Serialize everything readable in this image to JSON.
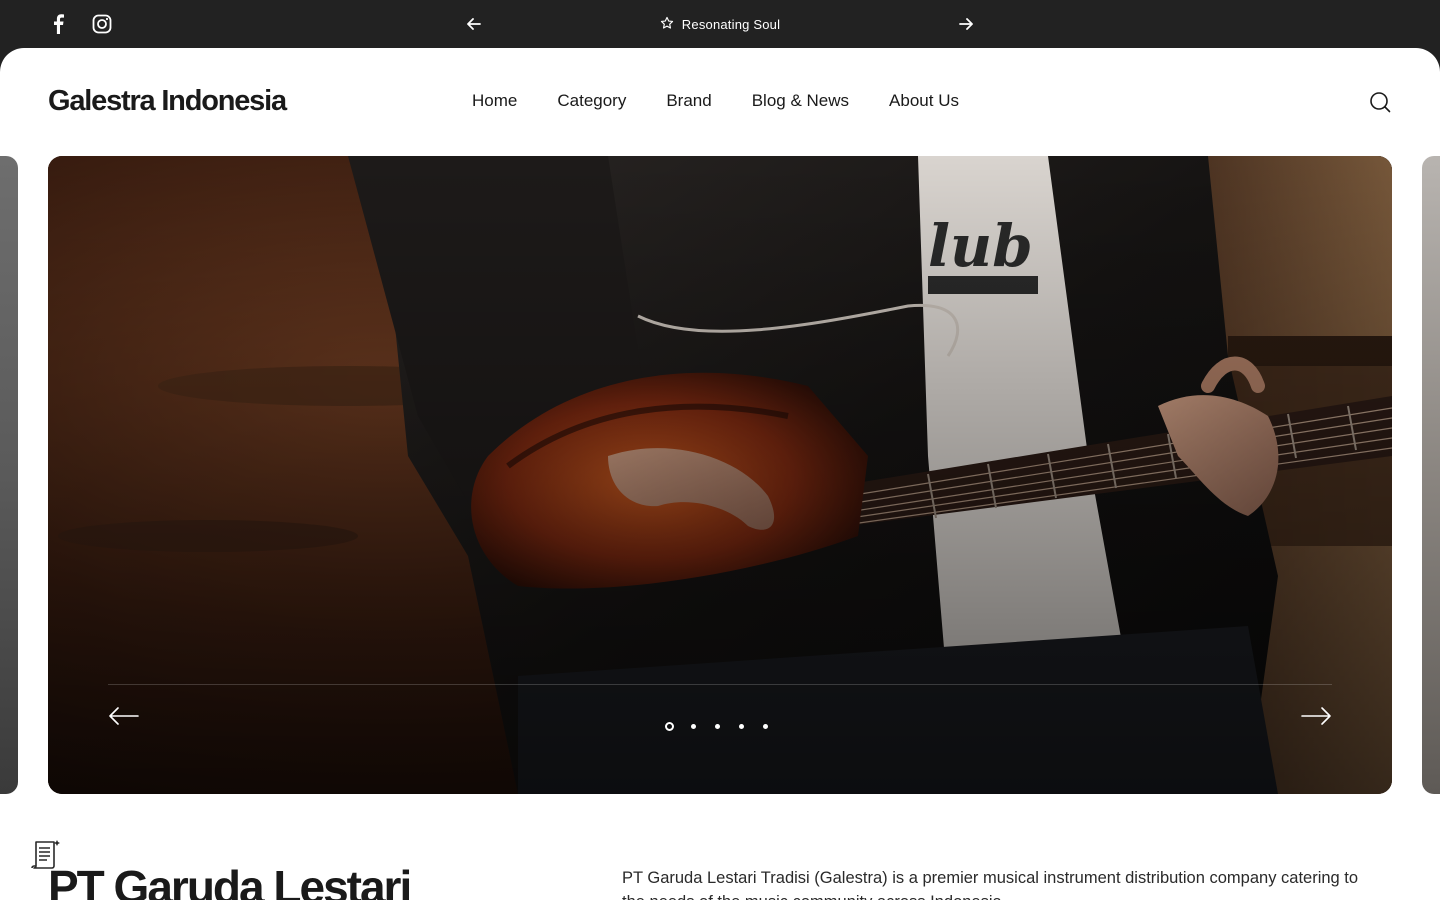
{
  "topbar": {
    "social": [
      {
        "name": "facebook-icon"
      },
      {
        "name": "instagram-icon"
      }
    ],
    "announcement": "Resonating Soul",
    "announcement_icon": "star-icon"
  },
  "header": {
    "logo": "Galestra Indonesia",
    "nav": [
      {
        "label": "Home"
      },
      {
        "label": "Category"
      },
      {
        "label": "Brand"
      },
      {
        "label": "Blog & News"
      },
      {
        "label": "About Us"
      }
    ],
    "search_icon": "search-icon"
  },
  "hero": {
    "slide_count": 5,
    "active_slide": 1,
    "image_subject": "guitarist-playing-electric-guitar"
  },
  "about": {
    "title": "PT Garuda Lestari",
    "text": "PT Garuda Lestari Tradisi (Galestra) is a premier musical instrument distribution company catering to the needs of the music community across Indonesia."
  },
  "colors": {
    "topbar_bg": "#222222",
    "page_bg": "#ffffff",
    "text": "#1a1a1a"
  }
}
